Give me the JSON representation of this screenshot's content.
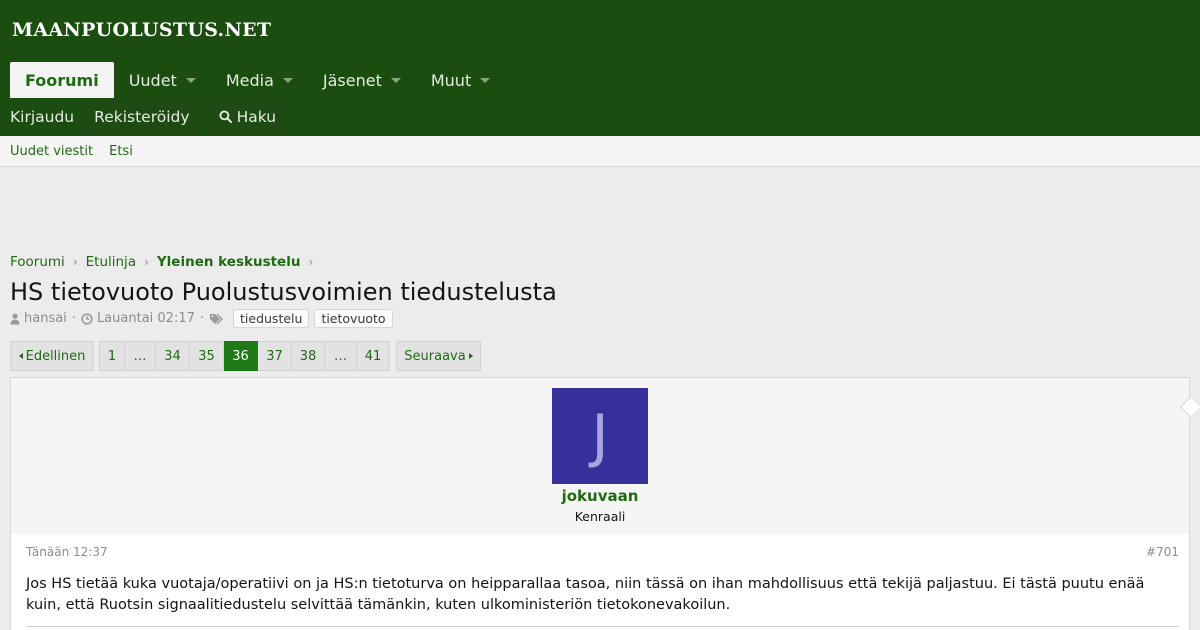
{
  "site": {
    "logo_text": "MAANPUOLUSTUS.NET"
  },
  "nav": {
    "tabs": [
      {
        "label": "Foorumi",
        "active": true,
        "dropdown": false
      },
      {
        "label": "Uudet",
        "active": false,
        "dropdown": true
      },
      {
        "label": "Media",
        "active": false,
        "dropdown": true
      },
      {
        "label": "Jäsenet",
        "active": false,
        "dropdown": true
      },
      {
        "label": "Muut",
        "active": false,
        "dropdown": true
      }
    ],
    "login": "Kirjaudu",
    "register": "Rekisteröidy",
    "search": "Haku"
  },
  "subnav": {
    "new_posts": "Uudet viestit",
    "search": "Etsi"
  },
  "breadcrumb": [
    "Foorumi",
    "Etulinja",
    "Yleinen keskustelu"
  ],
  "thread": {
    "title": "HS tietovuoto Puolustusvoimien tiedustelusta",
    "author": "hansai",
    "date": "Lauantai 02:17",
    "tags": [
      "tiedustelu",
      "tietovuoto"
    ]
  },
  "pagination": {
    "prev": "Edellinen",
    "next": "Seuraava",
    "pages": [
      "1",
      "…",
      "34",
      "35",
      "36",
      "37",
      "38",
      "…",
      "41"
    ],
    "current": "36"
  },
  "post": {
    "avatar_letter": "J",
    "avatar_color": "#35309a",
    "username": "jokuvaan",
    "user_title": "Kenraali",
    "date": "Tänään 12:37",
    "number": "#701",
    "body": "Jos HS tietää kuka vuotaja/operatiivi on ja HS:n tietoturva on heipparallaa tasoa, niin tässä on ihan mahdollisuus että tekijä paljastuu. Ei tästä puutu enää kuin, että Ruotsin signaalitiedustelu selvittää tämänkin, kuten ulkoministeriön tietokonevakoilun."
  },
  "colors": {
    "header_bg": "#1a4d0f",
    "accent": "#1f6b12",
    "page_bg": "#ececec"
  }
}
